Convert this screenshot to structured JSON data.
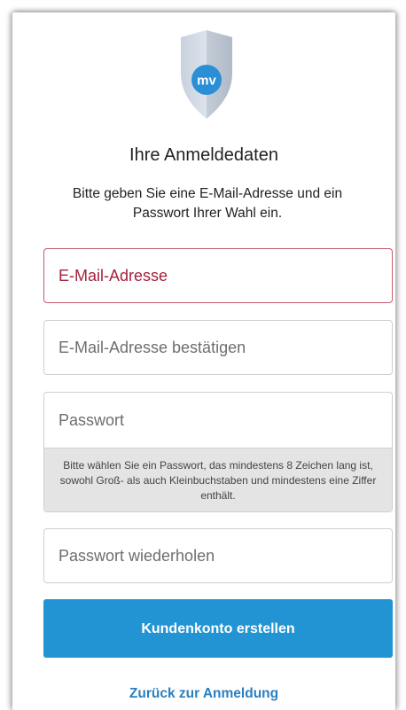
{
  "header": {
    "logo_text": "mv",
    "title": "Ihre Anmeldedaten",
    "subtitle": "Bitte geben Sie eine E-Mail-Adresse und ein Passwort Ihrer Wahl ein."
  },
  "form": {
    "email_placeholder": "E-Mail-Adresse",
    "email_confirm_placeholder": "E-Mail-Adresse bestätigen",
    "password_placeholder": "Passwort",
    "password_hint": "Bitte wählen Sie ein Passwort, das mindestens 8 Zeichen lang ist, sowohl Groß- als auch Kleinbuchstaben und mindestens eine Ziffer enthält.",
    "password_repeat_placeholder": "Passwort wiederholen",
    "submit_label": "Kundenkonto erstellen",
    "back_link": "Zurück zur Anmeldung"
  },
  "colors": {
    "accent": "#2394d3",
    "error": "#a3223f",
    "link": "#2a7fc0"
  },
  "icons": {
    "logo": "shield-icon"
  }
}
